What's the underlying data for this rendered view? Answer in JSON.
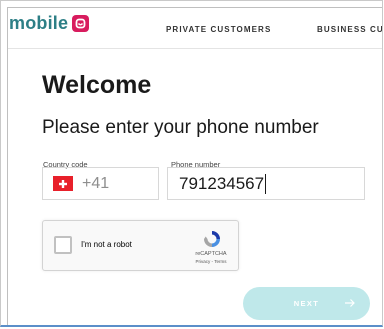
{
  "brand": {
    "name": "mobile",
    "color": "#2d7f86",
    "badge_color": "#d81c5e"
  },
  "nav": {
    "private_customers": "PRIVATE CUSTOMERS",
    "business_customers": "BUSINESS CUS"
  },
  "page": {
    "title": "Welcome",
    "subtitle": "Please enter your phone number"
  },
  "form": {
    "country_code_label": "Country code",
    "country_code_value": "+41",
    "country_flag": "swiss-flag-icon",
    "phone_label": "Phone number",
    "phone_value": "791234567"
  },
  "captcha": {
    "label": "I'm not a robot",
    "brand": "reCAPTCHA",
    "links": "Privacy - Terms",
    "checked": false
  },
  "actions": {
    "next_label": "NEXT",
    "next_enabled": false
  }
}
